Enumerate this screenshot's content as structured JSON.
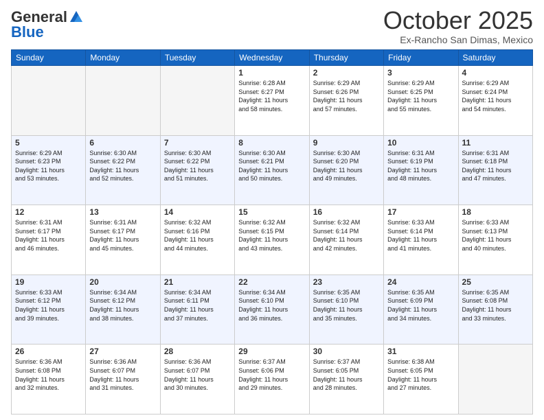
{
  "header": {
    "logo_general": "General",
    "logo_blue": "Blue",
    "month_title": "October 2025",
    "location": "Ex-Rancho San Dimas, Mexico"
  },
  "days_of_week": [
    "Sunday",
    "Monday",
    "Tuesday",
    "Wednesday",
    "Thursday",
    "Friday",
    "Saturday"
  ],
  "weeks": [
    {
      "days": [
        {
          "num": "",
          "info": ""
        },
        {
          "num": "",
          "info": ""
        },
        {
          "num": "",
          "info": ""
        },
        {
          "num": "1",
          "info": "Sunrise: 6:28 AM\nSunset: 6:27 PM\nDaylight: 11 hours\nand 58 minutes."
        },
        {
          "num": "2",
          "info": "Sunrise: 6:29 AM\nSunset: 6:26 PM\nDaylight: 11 hours\nand 57 minutes."
        },
        {
          "num": "3",
          "info": "Sunrise: 6:29 AM\nSunset: 6:25 PM\nDaylight: 11 hours\nand 55 minutes."
        },
        {
          "num": "4",
          "info": "Sunrise: 6:29 AM\nSunset: 6:24 PM\nDaylight: 11 hours\nand 54 minutes."
        }
      ]
    },
    {
      "days": [
        {
          "num": "5",
          "info": "Sunrise: 6:29 AM\nSunset: 6:23 PM\nDaylight: 11 hours\nand 53 minutes."
        },
        {
          "num": "6",
          "info": "Sunrise: 6:30 AM\nSunset: 6:22 PM\nDaylight: 11 hours\nand 52 minutes."
        },
        {
          "num": "7",
          "info": "Sunrise: 6:30 AM\nSunset: 6:22 PM\nDaylight: 11 hours\nand 51 minutes."
        },
        {
          "num": "8",
          "info": "Sunrise: 6:30 AM\nSunset: 6:21 PM\nDaylight: 11 hours\nand 50 minutes."
        },
        {
          "num": "9",
          "info": "Sunrise: 6:30 AM\nSunset: 6:20 PM\nDaylight: 11 hours\nand 49 minutes."
        },
        {
          "num": "10",
          "info": "Sunrise: 6:31 AM\nSunset: 6:19 PM\nDaylight: 11 hours\nand 48 minutes."
        },
        {
          "num": "11",
          "info": "Sunrise: 6:31 AM\nSunset: 6:18 PM\nDaylight: 11 hours\nand 47 minutes."
        }
      ]
    },
    {
      "days": [
        {
          "num": "12",
          "info": "Sunrise: 6:31 AM\nSunset: 6:17 PM\nDaylight: 11 hours\nand 46 minutes."
        },
        {
          "num": "13",
          "info": "Sunrise: 6:31 AM\nSunset: 6:17 PM\nDaylight: 11 hours\nand 45 minutes."
        },
        {
          "num": "14",
          "info": "Sunrise: 6:32 AM\nSunset: 6:16 PM\nDaylight: 11 hours\nand 44 minutes."
        },
        {
          "num": "15",
          "info": "Sunrise: 6:32 AM\nSunset: 6:15 PM\nDaylight: 11 hours\nand 43 minutes."
        },
        {
          "num": "16",
          "info": "Sunrise: 6:32 AM\nSunset: 6:14 PM\nDaylight: 11 hours\nand 42 minutes."
        },
        {
          "num": "17",
          "info": "Sunrise: 6:33 AM\nSunset: 6:14 PM\nDaylight: 11 hours\nand 41 minutes."
        },
        {
          "num": "18",
          "info": "Sunrise: 6:33 AM\nSunset: 6:13 PM\nDaylight: 11 hours\nand 40 minutes."
        }
      ]
    },
    {
      "days": [
        {
          "num": "19",
          "info": "Sunrise: 6:33 AM\nSunset: 6:12 PM\nDaylight: 11 hours\nand 39 minutes."
        },
        {
          "num": "20",
          "info": "Sunrise: 6:34 AM\nSunset: 6:12 PM\nDaylight: 11 hours\nand 38 minutes."
        },
        {
          "num": "21",
          "info": "Sunrise: 6:34 AM\nSunset: 6:11 PM\nDaylight: 11 hours\nand 37 minutes."
        },
        {
          "num": "22",
          "info": "Sunrise: 6:34 AM\nSunset: 6:10 PM\nDaylight: 11 hours\nand 36 minutes."
        },
        {
          "num": "23",
          "info": "Sunrise: 6:35 AM\nSunset: 6:10 PM\nDaylight: 11 hours\nand 35 minutes."
        },
        {
          "num": "24",
          "info": "Sunrise: 6:35 AM\nSunset: 6:09 PM\nDaylight: 11 hours\nand 34 minutes."
        },
        {
          "num": "25",
          "info": "Sunrise: 6:35 AM\nSunset: 6:08 PM\nDaylight: 11 hours\nand 33 minutes."
        }
      ]
    },
    {
      "days": [
        {
          "num": "26",
          "info": "Sunrise: 6:36 AM\nSunset: 6:08 PM\nDaylight: 11 hours\nand 32 minutes."
        },
        {
          "num": "27",
          "info": "Sunrise: 6:36 AM\nSunset: 6:07 PM\nDaylight: 11 hours\nand 31 minutes."
        },
        {
          "num": "28",
          "info": "Sunrise: 6:36 AM\nSunset: 6:07 PM\nDaylight: 11 hours\nand 30 minutes."
        },
        {
          "num": "29",
          "info": "Sunrise: 6:37 AM\nSunset: 6:06 PM\nDaylight: 11 hours\nand 29 minutes."
        },
        {
          "num": "30",
          "info": "Sunrise: 6:37 AM\nSunset: 6:05 PM\nDaylight: 11 hours\nand 28 minutes."
        },
        {
          "num": "31",
          "info": "Sunrise: 6:38 AM\nSunset: 6:05 PM\nDaylight: 11 hours\nand 27 minutes."
        },
        {
          "num": "",
          "info": ""
        }
      ]
    }
  ]
}
